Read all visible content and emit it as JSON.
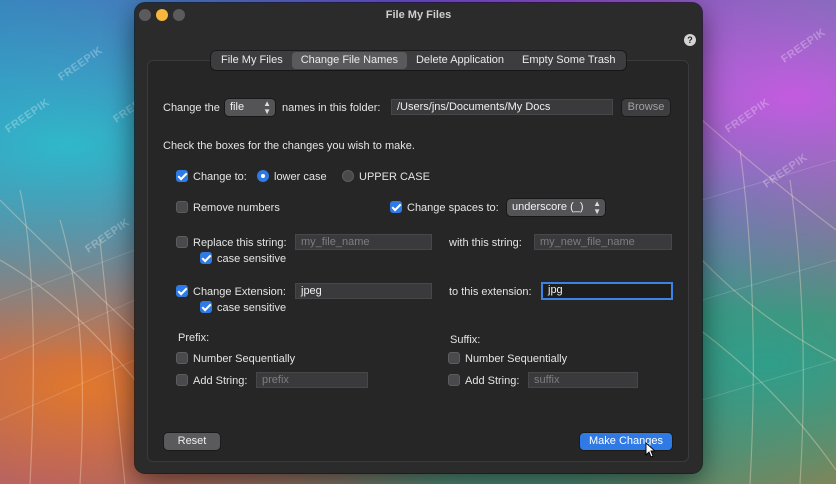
{
  "window": {
    "title": "File My Files",
    "help_label": "?"
  },
  "tabs": [
    {
      "label": "File My Files",
      "active": false
    },
    {
      "label": "Change File Names",
      "active": true
    },
    {
      "label": "Delete Application",
      "active": false
    },
    {
      "label": "Empty Some Trash",
      "active": false
    }
  ],
  "folder_row": {
    "prefix_label": "Change the",
    "type_value": "file",
    "suffix_label": "names in this folder:",
    "path_value": "/Users/jns/Documents/My Docs",
    "browse_label": "Browse"
  },
  "instructions": "Check the boxes for the changes you wish to make.",
  "change_to": {
    "label": "Change to:",
    "checked": true,
    "lower_label": "lower case",
    "upper_label": "UPPER CASE",
    "selected": "lower case"
  },
  "remove_numbers": {
    "label": "Remove numbers",
    "checked": false
  },
  "change_spaces": {
    "label": "Change spaces to:",
    "checked": true,
    "value": "underscore (_)"
  },
  "replace_string": {
    "label": "Replace this string:",
    "checked": false,
    "placeholder": "my_file_name",
    "with_label": "with this string:",
    "with_placeholder": "my_new_file_name",
    "case_label": "case sensitive",
    "case_checked": true
  },
  "change_extension": {
    "label": "Change Extension:",
    "checked": true,
    "value": "jpeg",
    "to_label": "to this extension:",
    "to_value": "jpg",
    "case_label": "case sensitive",
    "case_checked": true
  },
  "prefix": {
    "heading": "Prefix:",
    "sequential_label": "Number Sequentially",
    "sequential_checked": false,
    "add_label": "Add String:",
    "add_checked": false,
    "placeholder": "prefix"
  },
  "suffix": {
    "heading": "Suffix:",
    "sequential_label": "Number Sequentially",
    "sequential_checked": false,
    "add_label": "Add String:",
    "add_checked": false,
    "placeholder": "suffix"
  },
  "buttons": {
    "reset": "Reset",
    "make_changes": "Make Changes"
  },
  "watermark": "FREEPIK",
  "colors": {
    "accent": "#2f7ae5",
    "window_bg": "#2b2b2c",
    "minimize": "#f6b73c"
  }
}
